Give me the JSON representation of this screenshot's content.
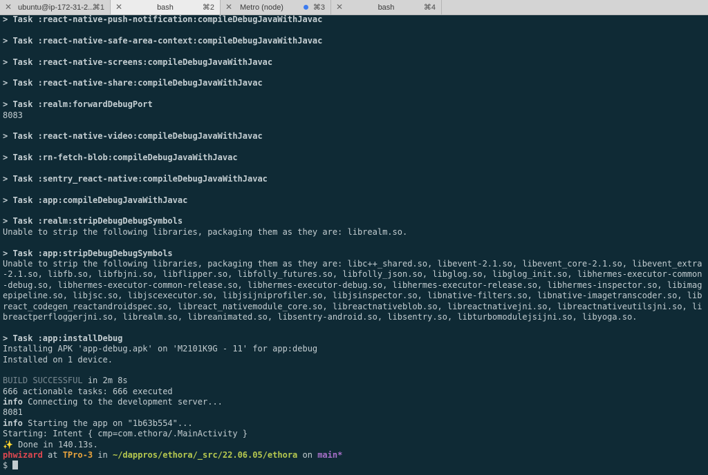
{
  "tabs": [
    {
      "label": "ubuntu@ip-172-31-2...",
      "shortcut": "⌘1"
    },
    {
      "label": "bash",
      "shortcut": "⌘2"
    },
    {
      "label": "Metro (node)",
      "shortcut": "⌘3"
    },
    {
      "label": "bash",
      "shortcut": "⌘4"
    }
  ],
  "tab_close_glyph": "✕",
  "colors": {
    "background": "#0f2a35",
    "prompt_user": "#e04850",
    "prompt_host": "#e8a33d",
    "prompt_path": "#b6c84f",
    "prompt_branch": "#a66fc8",
    "activity_dot": "#3b7bf0"
  },
  "terminal": {
    "lines": [
      "> Task :react-native-push-notification:compileDebugJavaWithJavac",
      "",
      "> Task :react-native-safe-area-context:compileDebugJavaWithJavac",
      "",
      "> Task :react-native-screens:compileDebugJavaWithJavac",
      "",
      "> Task :react-native-share:compileDebugJavaWithJavac",
      "",
      "> Task :realm:forwardDebugPort",
      "8083",
      "",
      "> Task :react-native-video:compileDebugJavaWithJavac",
      "",
      "> Task :rn-fetch-blob:compileDebugJavaWithJavac",
      "",
      "> Task :sentry_react-native:compileDebugJavaWithJavac",
      "",
      "> Task :app:compileDebugJavaWithJavac",
      "",
      "> Task :realm:stripDebugDebugSymbols",
      "Unable to strip the following libraries, packaging them as they are: librealm.so.",
      "",
      "> Task :app:stripDebugDebugSymbols",
      "Unable to strip the following libraries, packaging them as they are: libc++_shared.so, libevent-2.1.so, libevent_core-2.1.so, libevent_extra",
      "-2.1.so, libfb.so, libfbjni.so, libflipper.so, libfolly_futures.so, libfolly_json.so, libglog.so, libglog_init.so, libhermes-executor-common",
      "-debug.so, libhermes-executor-common-release.so, libhermes-executor-debug.so, libhermes-executor-release.so, libhermes-inspector.so, libimag",
      "epipeline.so, libjsc.so, libjscexecutor.so, libjsijniprofiler.so, libjsinspector.so, libnative-filters.so, libnative-imagetranscoder.so, lib",
      "react_codegen_reactandroidspec.so, libreact_nativemodule_core.so, libreactnativeblob.so, libreactnativejni.so, libreactnativeutilsjni.so, li",
      "breactperfloggerjni.so, librealm.so, libreanimated.so, libsentry-android.so, libsentry.so, libturbomodulejsijni.so, libyoga.so.",
      "",
      "> Task :app:installDebug",
      "Installing APK 'app-debug.apk' on 'M2101K9G - 11' for app:debug",
      "Installed on 1 device.",
      "",
      "BUILD SUCCESSFUL in 2m 8s",
      "666 actionable tasks: 666 executed",
      "info Connecting to the development server...",
      "8081",
      "info Starting the app on \"1b63b554\"...",
      "Starting: Intent { cmp=com.ethora/.MainActivity }",
      "✨ Done in 140.13s."
    ],
    "prompt": {
      "user": "phwizard",
      "at": " at ",
      "host": "TPro-3",
      "in": " in ",
      "path": "~/dappros/ethora/_src/22.06.05/ethora",
      "on": " on ",
      "branch": "main*",
      "symbol": "$ "
    }
  }
}
